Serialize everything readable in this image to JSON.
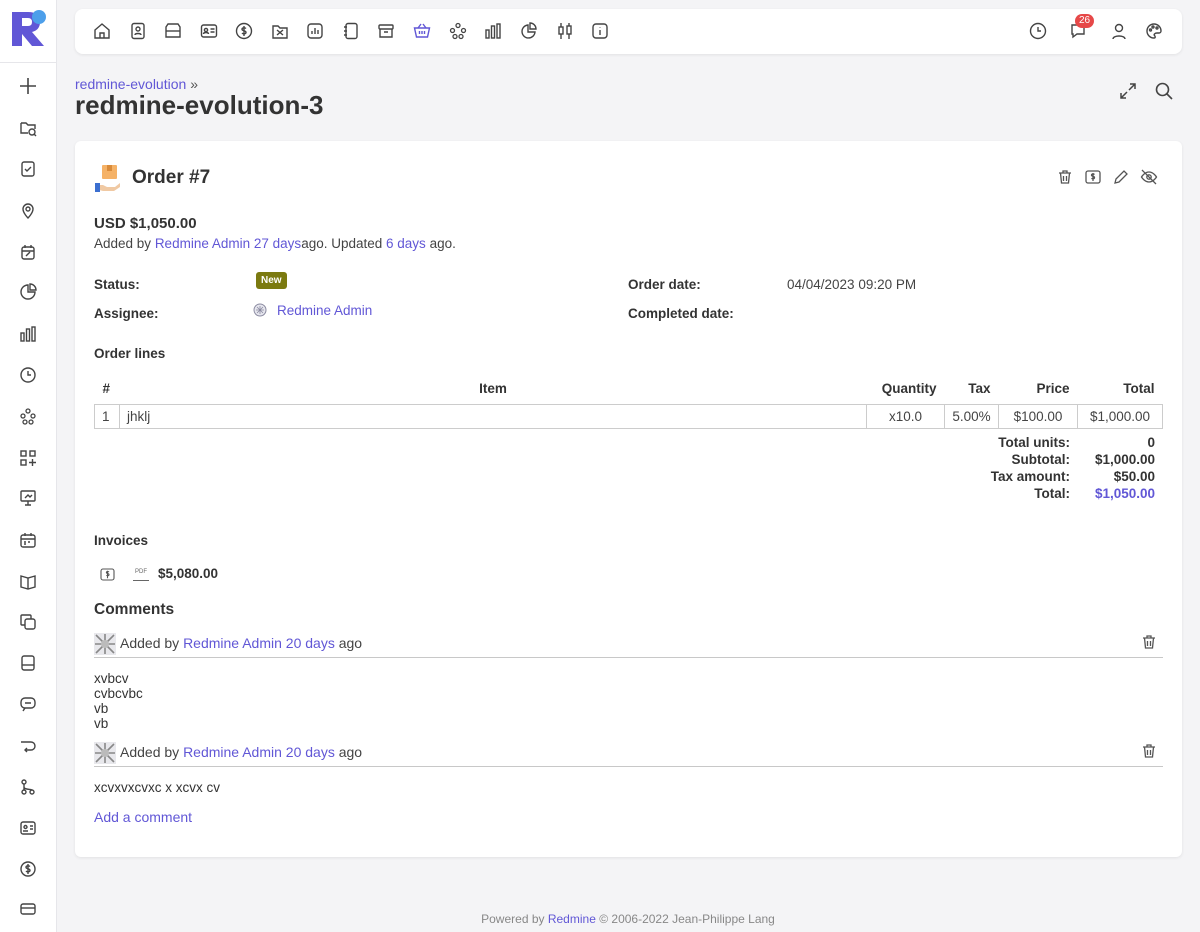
{
  "topbar": {
    "icons": [
      "home-icon",
      "contacts-icon",
      "projects-icon",
      "contact-card-icon",
      "deals-icon",
      "activity-icon",
      "reports-icon",
      "notebook-icon",
      "archive-icon",
      "orders-basket-icon",
      "people-icon",
      "chart-bars-icon",
      "pie-chart-icon",
      "candlestick-icon",
      "info-icon"
    ],
    "active": "orders-basket-icon",
    "right_icons": [
      "clock-icon",
      "notifications-icon",
      "user-icon",
      "palette-icon"
    ],
    "notifications_count": "26"
  },
  "sidebar": {
    "icons": [
      "plus-icon",
      "folder-search-icon",
      "checklist-icon",
      "location-icon",
      "calendar-edit-icon",
      "pie-chart-icon",
      "bar-chart-icon",
      "clock-icon",
      "people-icon",
      "apps-add-icon",
      "presentation-icon",
      "calendar-icon",
      "book-icon",
      "copy-icon",
      "document-icon",
      "chat-icon",
      "transfer-icon",
      "branch-icon",
      "id-card-icon",
      "dollar-icon",
      "card-icon"
    ]
  },
  "header": {
    "breadcrumb": "redmine-evolution",
    "breadcrumb_sep": "»",
    "title": "redmine-evolution-3"
  },
  "order": {
    "title": "Order #7",
    "amount": "USD $1,050.00",
    "meta": {
      "added_by": "Added by",
      "author": "Redmine Admin",
      "created_ago": "27 days",
      "ago_updated": "ago. Updated",
      "updated_ago": "6 days",
      "ago_end": "ago."
    },
    "fields": {
      "status_label": "Status:",
      "status_value": "New",
      "assignee_label": "Assignee:",
      "assignee_value": "Redmine Admin",
      "order_date_label": "Order date:",
      "order_date_value": "04/04/2023 09:20 PM",
      "completed_date_label": "Completed date:"
    },
    "lines_title": "Order lines",
    "lines": {
      "headers": [
        "#",
        "Item",
        "Quantity",
        "Tax",
        "Price",
        "Total"
      ],
      "rows": [
        [
          "1",
          "jhklj",
          "x10.0",
          "5.00%",
          "$100.00",
          "$1,000.00"
        ]
      ]
    },
    "totals": {
      "units_label": "Total units:",
      "units": "0",
      "subtotal_label": "Subtotal:",
      "subtotal": "$1,000.00",
      "tax_label": "Tax amount:",
      "tax": "$50.00",
      "total_label": "Total:",
      "total": "$1,050.00"
    },
    "invoices_title": "Invoices",
    "invoice_amount": "$5,080.00",
    "pdf_label": "PDF"
  },
  "comments": {
    "title": "Comments",
    "items": [
      {
        "prefix": "Added by",
        "author": "Redmine Admin",
        "when": "20 days",
        "suffix": "ago",
        "lines": [
          "xvbcv",
          "cvbcvbc",
          "vb",
          "vb"
        ]
      },
      {
        "prefix": "Added by",
        "author": "Redmine Admin",
        "when": "20 days",
        "suffix": "ago",
        "lines": [
          "xcvxvxcvxc x xcvx cv"
        ]
      }
    ],
    "add_link": "Add a comment"
  },
  "footer": {
    "powered_by": "Powered by",
    "app": "Redmine",
    "copyright": "© 2006-2022 Jean-Philippe Lang"
  },
  "colors": {
    "accent": "#6157d6",
    "status_new": "#7b7a10",
    "badge": "#e64848"
  }
}
